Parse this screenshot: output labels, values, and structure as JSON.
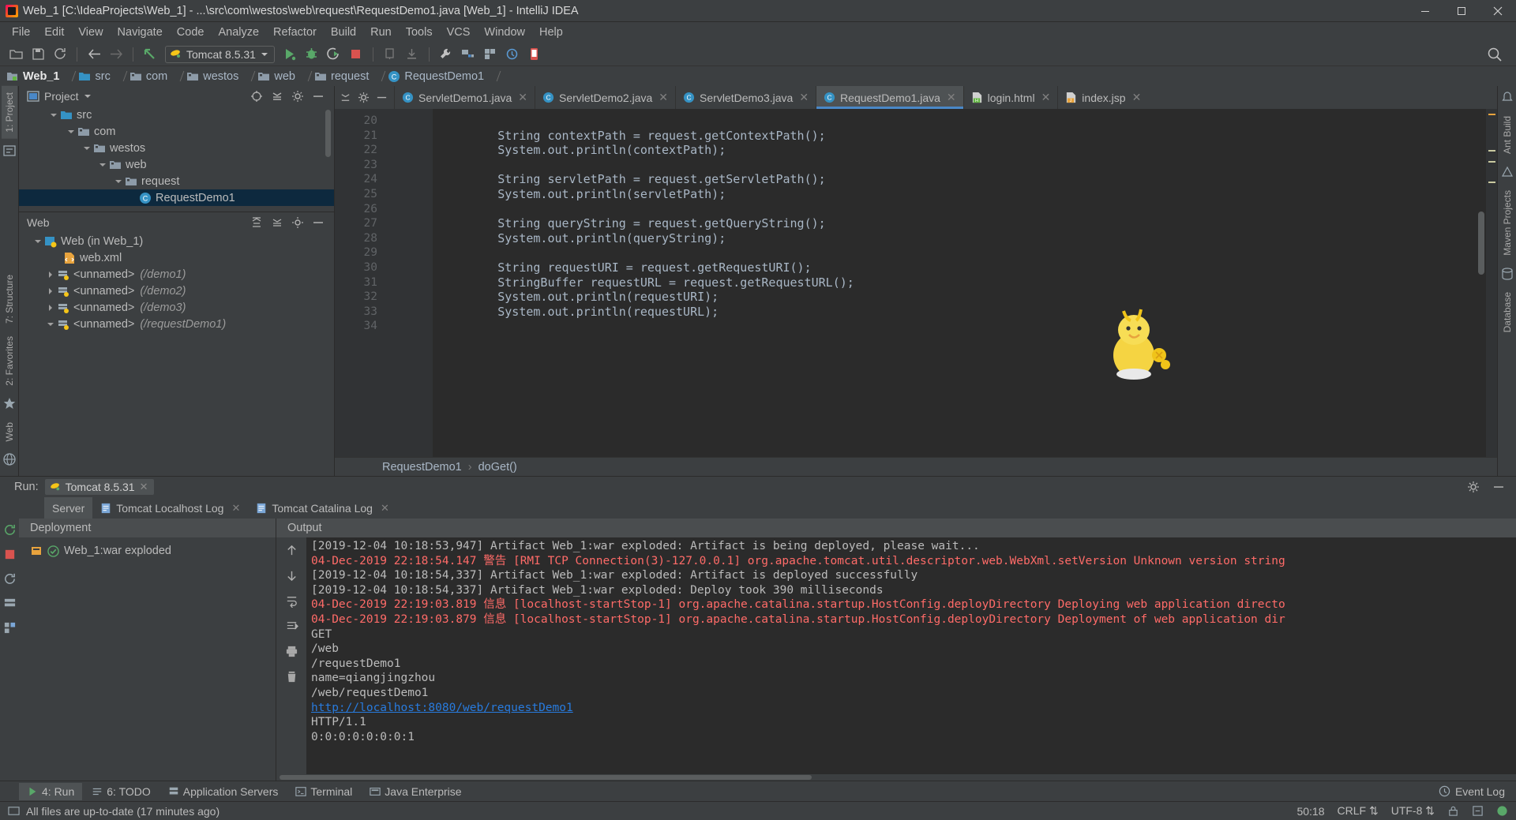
{
  "window": {
    "title": "Web_1 [C:\\IdeaProjects\\Web_1] - ...\\src\\com\\westos\\web\\request\\RequestDemo1.java [Web_1] - IntelliJ IDEA",
    "minimize_label": "minimize-icon",
    "maximize_label": "maximize-icon",
    "close_label": "close-icon"
  },
  "menu": [
    {
      "label": "File"
    },
    {
      "label": "Edit"
    },
    {
      "label": "View"
    },
    {
      "label": "Navigate"
    },
    {
      "label": "Code"
    },
    {
      "label": "Analyze"
    },
    {
      "label": "Refactor"
    },
    {
      "label": "Build"
    },
    {
      "label": "Run"
    },
    {
      "label": "Tools"
    },
    {
      "label": "VCS"
    },
    {
      "label": "Window"
    },
    {
      "label": "Help"
    }
  ],
  "toolbar": {
    "run_config": "Tomcat 8.5.31",
    "icons": [
      "open-icon",
      "save-icon",
      "sync-icon",
      "back-icon",
      "forward-icon",
      "arrow-up-left-icon",
      "run-icon",
      "debug-icon",
      "run-coverage-icon",
      "stop-icon",
      "profile-icon",
      "install-icon",
      "settings-wrench-icon",
      "project-structure-icon",
      "sdk-icon",
      "update-icon",
      "mobile-icon"
    ],
    "search_icon": "search-icon"
  },
  "breadcrumb": [
    {
      "label": "Web_1",
      "icon": "module-icon"
    },
    {
      "label": "src",
      "icon": "folder-icon"
    },
    {
      "label": "com",
      "icon": "package-icon"
    },
    {
      "label": "westos",
      "icon": "package-icon"
    },
    {
      "label": "web",
      "icon": "package-icon"
    },
    {
      "label": "request",
      "icon": "package-icon"
    },
    {
      "label": "RequestDemo1",
      "icon": "class-icon"
    }
  ],
  "left_rail": {
    "top": [
      "1: Project"
    ],
    "bottom": [
      "7: Structure",
      "2: Favorites",
      "Web"
    ]
  },
  "right_rail": {
    "items": [
      "Ant Build",
      "Maven Projects",
      "Database"
    ]
  },
  "project_panel": {
    "title": "Project",
    "tree": [
      {
        "label": "src",
        "depth": 1,
        "arrow": "down",
        "icon": "source-folder-icon"
      },
      {
        "label": "com",
        "depth": 2,
        "arrow": "down",
        "icon": "package-icon"
      },
      {
        "label": "westos",
        "depth": 3,
        "arrow": "down",
        "icon": "package-icon"
      },
      {
        "label": "web",
        "depth": 4,
        "arrow": "down",
        "icon": "package-icon"
      },
      {
        "label": "request",
        "depth": 5,
        "arrow": "down",
        "icon": "package-icon"
      },
      {
        "label": "RequestDemo1",
        "depth": 6,
        "arrow": "none",
        "icon": "class-icon",
        "selected": true
      }
    ]
  },
  "web_panel": {
    "title": "Web",
    "tree": [
      {
        "label": "Web (in Web_1)",
        "sub": "",
        "depth": 0,
        "arrow": "down",
        "icon": "web-facet-icon"
      },
      {
        "label": "web.xml",
        "sub": "",
        "depth": 1,
        "arrow": "none",
        "icon": "xml-icon"
      },
      {
        "label": "<unnamed>",
        "sub": "(/demo1)",
        "depth": 1,
        "arrow": "right",
        "icon": "servlet-icon"
      },
      {
        "label": "<unnamed>",
        "sub": "(/demo2)",
        "depth": 1,
        "arrow": "right",
        "icon": "servlet-icon"
      },
      {
        "label": "<unnamed>",
        "sub": "(/demo3)",
        "depth": 1,
        "arrow": "right",
        "icon": "servlet-icon"
      },
      {
        "label": "<unnamed>",
        "sub": "(/requestDemo1)",
        "depth": 1,
        "arrow": "down",
        "icon": "servlet-icon"
      }
    ]
  },
  "editor_tabs": [
    {
      "label": "ServletDemo1.java",
      "icon": "java-class-icon",
      "active": false
    },
    {
      "label": "ServletDemo2.java",
      "icon": "java-class-icon",
      "active": false
    },
    {
      "label": "ServletDemo3.java",
      "icon": "java-class-icon",
      "active": false
    },
    {
      "label": "RequestDemo1.java",
      "icon": "java-class-icon",
      "active": true
    },
    {
      "label": "login.html",
      "icon": "html-icon",
      "active": false
    },
    {
      "label": "index.jsp",
      "icon": "jsp-icon",
      "active": false
    }
  ],
  "editor": {
    "first_line": 20,
    "lines": [
      {
        "n": 20,
        "text": ""
      },
      {
        "n": 21,
        "text": "        String contextPath = request.getContextPath();"
      },
      {
        "n": 22,
        "text": "        System.out.println(contextPath);"
      },
      {
        "n": 23,
        "text": ""
      },
      {
        "n": 24,
        "text": "        String servletPath = request.getServletPath();"
      },
      {
        "n": 25,
        "text": "        System.out.println(servletPath);"
      },
      {
        "n": 26,
        "text": ""
      },
      {
        "n": 27,
        "text": "        String queryString = request.getQueryString();"
      },
      {
        "n": 28,
        "text": "        System.out.println(queryString);"
      },
      {
        "n": 29,
        "text": ""
      },
      {
        "n": 30,
        "text": "        String requestURI = request.getRequestURI();"
      },
      {
        "n": 31,
        "text": "        StringBuffer requestURL = request.getRequestURL();"
      },
      {
        "n": 32,
        "text": "        System.out.println(requestURI);"
      },
      {
        "n": 33,
        "text": "        System.out.println(requestURL);"
      },
      {
        "n": 34,
        "text": ""
      }
    ],
    "breadcrumb": [
      "RequestDemo1",
      "doGet()"
    ]
  },
  "run_panel": {
    "label": "Run:",
    "config_name": "Tomcat 8.5.31",
    "tabs": [
      {
        "label": "Server",
        "active": true,
        "closable": false
      },
      {
        "label": "Tomcat Localhost Log",
        "active": false,
        "closable": true
      },
      {
        "label": "Tomcat Catalina Log",
        "active": false,
        "closable": true
      }
    ],
    "deployment_header": "Deployment",
    "deployment_item": "Web_1:war exploded",
    "output_header": "Output",
    "console": [
      {
        "text": "[2019-12-04 10:18:53,947] Artifact Web_1:war exploded: Artifact is being deployed, please wait...",
        "type": "normal"
      },
      {
        "text": "04-Dec-2019 22:18:54.147 警告 [RMI TCP Connection(3)-127.0.0.1] org.apache.tomcat.util.descriptor.web.WebXml.setVersion Unknown version string",
        "type": "error"
      },
      {
        "text": "[2019-12-04 10:18:54,337] Artifact Web_1:war exploded: Artifact is deployed successfully",
        "type": "normal"
      },
      {
        "text": "[2019-12-04 10:18:54,337] Artifact Web_1:war exploded: Deploy took 390 milliseconds",
        "type": "normal"
      },
      {
        "text": "04-Dec-2019 22:19:03.819 信息 [localhost-startStop-1] org.apache.catalina.startup.HostConfig.deployDirectory Deploying web application directo",
        "type": "error"
      },
      {
        "text": "04-Dec-2019 22:19:03.879 信息 [localhost-startStop-1] org.apache.catalina.startup.HostConfig.deployDirectory Deployment of web application dir",
        "type": "error"
      },
      {
        "text": "GET",
        "type": "normal"
      },
      {
        "text": "/web",
        "type": "normal"
      },
      {
        "text": "/requestDemo1",
        "type": "normal"
      },
      {
        "text": "name=qiangjingzhou",
        "type": "normal"
      },
      {
        "text": "/web/requestDemo1",
        "type": "normal"
      },
      {
        "text": "http://localhost:8080/web/requestDemo1",
        "type": "link"
      },
      {
        "text": "HTTP/1.1",
        "type": "normal"
      },
      {
        "text": "0:0:0:0:0:0:0:1",
        "type": "normal"
      }
    ]
  },
  "bottom_bar": {
    "items": [
      {
        "label": "4: Run",
        "icon": "run-icon",
        "active": true
      },
      {
        "label": "6: TODO",
        "icon": "todo-icon",
        "active": false
      },
      {
        "label": "Application Servers",
        "icon": "server-icon",
        "active": false
      },
      {
        "label": "Terminal",
        "icon": "terminal-icon",
        "active": false
      },
      {
        "label": "Java Enterprise",
        "icon": "javaee-icon",
        "active": false
      }
    ],
    "event_log": "Event Log"
  },
  "status_bar": {
    "message": "All files are up-to-date (17 minutes ago)",
    "caret": "50:18",
    "line_sep": "CRLF",
    "encoding": "UTF-8"
  },
  "colors": {
    "accent_blue": "#4a88c7",
    "selection_blue": "#0d293e",
    "panel_bg": "#3c3f41",
    "editor_bg": "#2b2b2b",
    "text": "#bbbbbb",
    "code_text": "#a9b7c6",
    "keyword_orange": "#cc7832",
    "field_purple": "#9876aa",
    "error_red": "#ff6b68",
    "link_blue": "#287bde",
    "green_run": "#59a869"
  }
}
